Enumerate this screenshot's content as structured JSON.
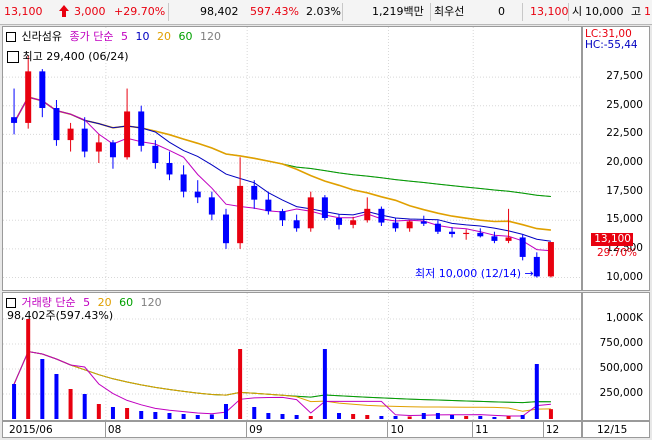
{
  "topbar": {
    "price": "13,100",
    "up_icon": "up-arrow-icon",
    "change": "3,000",
    "change_pct": "+29.70%",
    "volume": "98,402",
    "vol_ratio": "597.43%",
    "turnover": "2.03%",
    "amount": "1,219백만",
    "pref_label": "최우선",
    "pref_value": "0",
    "price2": "13,100",
    "open_label": "시",
    "open_value": "10,000",
    "high_label": "고",
    "high_value": "1"
  },
  "price_panel": {
    "title": "신라섬유",
    "legend_prefix": "종가 단순",
    "ma": [
      "5",
      "10",
      "20",
      "60",
      "120"
    ],
    "high_note": "최고 29,400 (06/24)",
    "low_note": "최저 10,000 (12/14)",
    "lc": "LC:31,00",
    "hc": "HC:-55,44",
    "last_price": "13,100",
    "last_pct": "29.70%",
    "yticks": [
      "27,500",
      "25,000",
      "22,500",
      "20,000",
      "17,500",
      "15,000",
      "12,500",
      "10,000"
    ]
  },
  "volume_panel": {
    "legend_prefix": "거래량 단순",
    "ma": [
      "5",
      "20",
      "60",
      "120"
    ],
    "current": "98,402주(597.43%)",
    "yticks": [
      "1,000K",
      "750,000",
      "500,000",
      "250,000"
    ]
  },
  "date_axis": {
    "labels": [
      "2015/06",
      "08",
      "09",
      "10",
      "11",
      "12"
    ],
    "last": "12/15"
  },
  "colors": {
    "up": "#e8000f",
    "down": "#0000ff",
    "ma5": "#c000c0",
    "ma10": "#0000c0",
    "ma20": "#e0a000",
    "ma60": "#00a000",
    "ma120": "#808080"
  },
  "chart_data": {
    "type": "candlestick",
    "title": "신라섬유",
    "ylim": [
      9000,
      31000
    ],
    "ohlc_values": [
      [
        24000,
        26500,
        22500,
        23500
      ],
      [
        23500,
        29400,
        23000,
        28000
      ],
      [
        28000,
        28200,
        24000,
        24800
      ],
      [
        24800,
        25500,
        21500,
        22000
      ],
      [
        22000,
        23500,
        21000,
        23000
      ],
      [
        23000,
        24000,
        20500,
        21000
      ],
      [
        21000,
        22500,
        20000,
        21800
      ],
      [
        21800,
        22000,
        19500,
        20500
      ],
      [
        20500,
        26500,
        20300,
        24500
      ],
      [
        24500,
        25000,
        21000,
        21500
      ],
      [
        21500,
        22000,
        19500,
        20000
      ],
      [
        20000,
        21000,
        18500,
        19000
      ],
      [
        19000,
        19800,
        17000,
        17500
      ],
      [
        17500,
        18500,
        16500,
        17000
      ],
      [
        17000,
        17500,
        15000,
        15500
      ],
      [
        15500,
        16000,
        12500,
        13000
      ],
      [
        13000,
        20500,
        12500,
        18000
      ],
      [
        18000,
        18500,
        16000,
        16800
      ],
      [
        16800,
        17500,
        15500,
        15800
      ],
      [
        15800,
        16000,
        14500,
        15000
      ],
      [
        15000,
        15500,
        14000,
        14300
      ],
      [
        14300,
        17500,
        14000,
        17000
      ],
      [
        17000,
        17200,
        15000,
        15200
      ],
      [
        15200,
        15500,
        14200,
        14600
      ],
      [
        14600,
        15300,
        14300,
        15000
      ],
      [
        15000,
        17000,
        14800,
        16000
      ],
      [
        16000,
        16200,
        14500,
        14800
      ],
      [
        14800,
        15200,
        14000,
        14300
      ],
      [
        14300,
        15000,
        14000,
        14900
      ],
      [
        14900,
        15400,
        14500,
        14700
      ],
      [
        14700,
        15000,
        13800,
        14000
      ],
      [
        14000,
        14400,
        13500,
        13800
      ],
      [
        13800,
        14200,
        13300,
        13900
      ],
      [
        13900,
        14300,
        13500,
        13600
      ],
      [
        13600,
        14000,
        13000,
        13200
      ],
      [
        13200,
        16000,
        13000,
        13500
      ],
      [
        13500,
        13800,
        11500,
        11800
      ],
      [
        11800,
        12200,
        10000,
        10100
      ],
      [
        10100,
        13100,
        10000,
        13100
      ]
    ],
    "volume_values": [
      350000,
      1000000,
      600000,
      450000,
      300000,
      250000,
      150000,
      120000,
      110000,
      80000,
      70000,
      60000,
      50000,
      40000,
      45000,
      150000,
      700000,
      120000,
      60000,
      50000,
      40000,
      30000,
      700000,
      60000,
      50000,
      40000,
      30000,
      30000,
      25000,
      60000,
      60000,
      40000,
      30000,
      30000,
      20000,
      30000,
      40000,
      550000,
      98402
    ]
  }
}
